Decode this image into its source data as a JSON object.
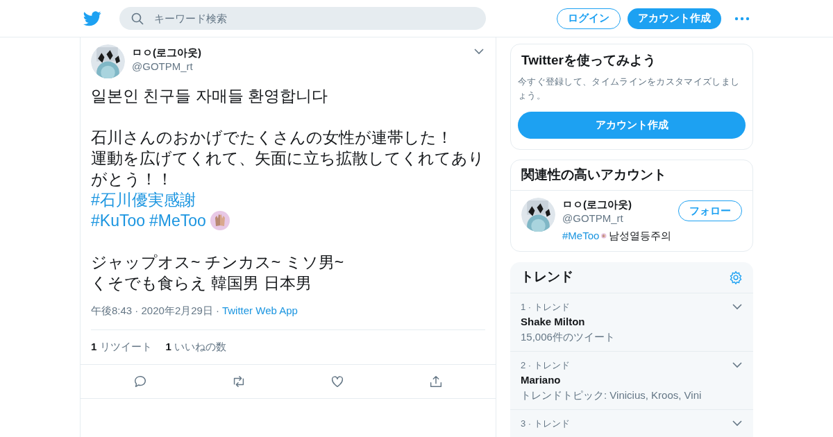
{
  "header": {
    "search": {
      "placeholder": "キーワード検索"
    },
    "login": "ログイン",
    "signup": "アカウント作成"
  },
  "tweet": {
    "name": "ㅁㅇ(로그아웃)",
    "handle": "@GOTPM_rt",
    "body": [
      {
        "kind": "text",
        "text": "일본인 친구들 자매들 환영합니다"
      },
      {
        "kind": "gap"
      },
      {
        "kind": "text",
        "text": "石川さんのおかげでたくさんの女性が連帯した！"
      },
      {
        "kind": "text",
        "text": "運動を広げてくれて、矢面に立ち拡散してくれてありがとう！！"
      },
      {
        "kind": "tags",
        "tags": [
          "#石川優実感謝"
        ],
        "emoji": false
      },
      {
        "kind": "tags",
        "tags": [
          "#KuToo",
          "#MeToo"
        ],
        "emoji": true
      },
      {
        "kind": "gap"
      },
      {
        "kind": "text",
        "text": "ジャップオス~ チンカス~ ミソ男~"
      },
      {
        "kind": "text",
        "text": "くそでも食らえ 韓国男 日本男"
      }
    ],
    "time": "午後8:43 · 2020年2月29日",
    "separator": "·",
    "source": "Twitter Web App",
    "stats": [
      {
        "count": "1",
        "label": "リツイート"
      },
      {
        "count": "1",
        "label": "いいねの数"
      }
    ]
  },
  "signup_card": {
    "title": "Twitterを使ってみよう",
    "text": "今すぐ登録して、タイムラインをカスタマイズしましょう。",
    "button": "アカウント作成"
  },
  "related": {
    "title": "関連性の高いアカウント",
    "account": {
      "name": "ㅁㅇ(로그아웃)",
      "handle": "@GOTPM_rt",
      "bio_tag": "#MeToo",
      "bio_text": "남성열등주의",
      "follow": "フォロー"
    }
  },
  "trends": {
    "title": "トレンド",
    "items": [
      {
        "rank": "1 · トレンド",
        "name": "Shake Milton",
        "meta": "15,006件のツイート"
      },
      {
        "rank": "2 · トレンド",
        "name": "Mariano",
        "meta": "トレンドトピック: Vinicius, Kroos, Vini"
      },
      {
        "rank": "3 · トレンド"
      }
    ]
  }
}
